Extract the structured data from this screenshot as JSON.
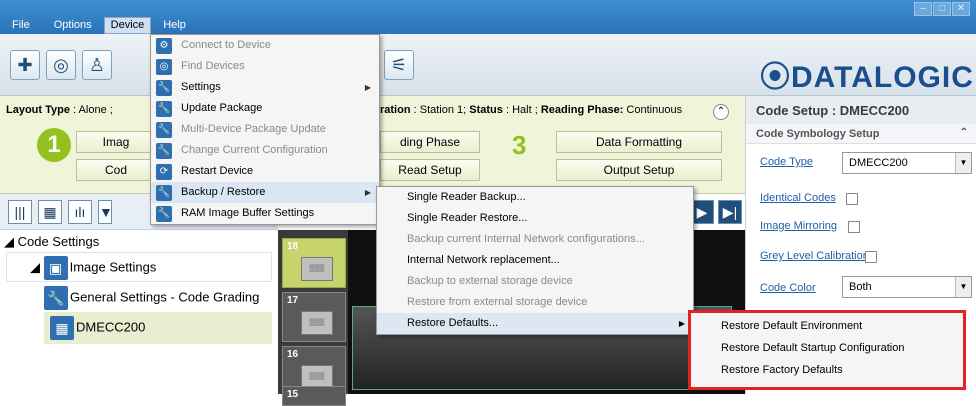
{
  "menubar": {
    "items": [
      "File",
      "Options",
      "Device",
      "Help"
    ]
  },
  "toolbar": {
    "logo": "⦿DATALOGIC"
  },
  "layout": {
    "layout_type_label": "Layout Type",
    "layout_type_value": ": Alone ;",
    "config_label": "ration",
    "config_value": ": Station 1;",
    "status_label": "Status",
    "status_value": ": Halt ;",
    "phase_label": "Reading Phase:",
    "phase_value": "Continuous",
    "step1": "1",
    "step3": "3",
    "btn_image": "Imag",
    "btn_code": "Cod",
    "btn_reading_phase": "ding Phase",
    "btn_read_setup": "Read Setup",
    "btn_data_formatting": "Data Formatting",
    "btn_output_setup": "Output Setup"
  },
  "right_panel": {
    "title": "Code Setup : DMECC200",
    "subsection": "Code Symbology Setup",
    "code_type_label": "Code Type",
    "code_type_value": "DMECC200",
    "identical_codes_label": "Identical Codes",
    "image_mirroring_label": "Image Mirroring",
    "grey_level_label": "Grey Level Calibration",
    "code_color_label": "Code Color",
    "code_color_value": "Both"
  },
  "tree": {
    "root": "Code Settings",
    "image_settings": "Image Settings",
    "general_settings": "General Settings - Code Grading",
    "dmecc": "DMECC200"
  },
  "filmstrip": {
    "items": [
      "18",
      "17",
      "16",
      "15"
    ]
  },
  "device_menu": {
    "items": [
      {
        "label": "Connect to Device",
        "disabled": true
      },
      {
        "label": "Find Devices",
        "disabled": true
      },
      {
        "label": "Settings",
        "disabled": false
      },
      {
        "label": "Update Package",
        "disabled": false
      },
      {
        "label": "Multi-Device Package Update",
        "disabled": true
      },
      {
        "label": "Change Current Configuration",
        "disabled": true
      },
      {
        "label": "Restart Device",
        "disabled": false
      },
      {
        "label": "Backup / Restore",
        "disabled": false
      },
      {
        "label": "RAM Image Buffer Settings",
        "disabled": false
      }
    ]
  },
  "backup_menu": {
    "items": [
      {
        "label": "Single Reader Backup...",
        "disabled": false
      },
      {
        "label": "Single Reader Restore...",
        "disabled": false
      },
      {
        "label": "Backup current Internal Network configurations...",
        "disabled": true
      },
      {
        "label": "Internal Network replacement...",
        "disabled": false
      },
      {
        "label": "Backup to external storage device",
        "disabled": true
      },
      {
        "label": "Restore from external storage device",
        "disabled": true
      },
      {
        "label": "Restore Defaults...",
        "disabled": false
      }
    ]
  },
  "restore_menu": {
    "items": [
      "Restore Default Environment",
      "Restore Default Startup Configuration",
      "Restore Factory Defaults"
    ]
  }
}
